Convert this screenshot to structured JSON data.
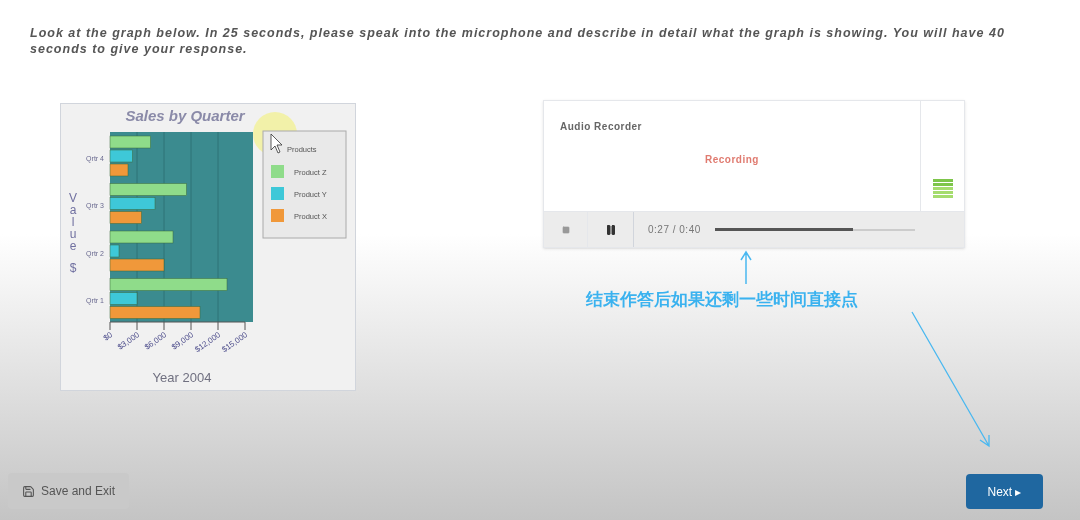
{
  "instructions": "Look at the graph below. In 25 seconds, please speak into the microphone and describe in detail what the graph is showing. You will have 40 seconds to give your response.",
  "chart": {
    "chart_data": {
      "type": "bar",
      "orientation": "horizontal",
      "title": "Sales by Quarter",
      "xlabel": "Year 2004",
      "ylabel": "Value $",
      "categories": [
        "Qrtr 4",
        "Qrtr 3",
        "Qrtr 2",
        "Qrtr 1"
      ],
      "series": [
        {
          "name": "Product Z",
          "color": "#8fdc8a",
          "values": [
            4500,
            8500,
            7000,
            13000
          ]
        },
        {
          "name": "Product Y",
          "color": "#3ec8d8",
          "values": [
            2500,
            5000,
            1000,
            3000
          ]
        },
        {
          "name": "Product X",
          "color": "#f0983a",
          "values": [
            2000,
            3500,
            6000,
            10000
          ]
        }
      ],
      "grid": true,
      "legend": {
        "title": "Products"
      },
      "xlim": [
        0,
        15000
      ],
      "xticks": [
        {
          "value": 0,
          "label": "$0"
        },
        {
          "value": 3000,
          "label": "$3,000"
        },
        {
          "value": 6000,
          "label": "$6,000"
        },
        {
          "value": 9000,
          "label": "$9,000"
        },
        {
          "value": 12000,
          "label": "$12,000"
        },
        {
          "value": 15000,
          "label": "$15,000"
        }
      ]
    },
    "kind": "chart"
  },
  "recorder": {
    "title": "Audio Recorder",
    "status": "Recording",
    "time": "0:27 / 0:40",
    "level": 0.69
  },
  "annotation": {
    "text": "结束作答后如果还剩一些时间直接点"
  },
  "buttons": {
    "save": "Save and Exit",
    "next": "Next ▸"
  }
}
